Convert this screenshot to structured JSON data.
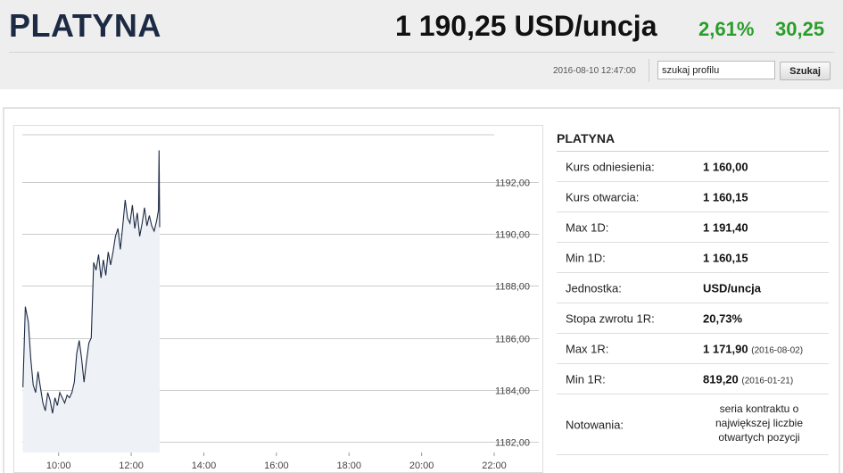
{
  "header": {
    "title": "PLATYNA",
    "price": "1 190,25 USD/uncja",
    "change_pct": "2,61%",
    "change_abs": "30,25",
    "timestamp": "2016-08-10 12:47:00",
    "search_value": "szukaj profilu",
    "search_button": "Szukaj",
    "accent_color": "#2a9d2a"
  },
  "info": {
    "title": "PLATYNA",
    "rows": [
      {
        "label": "Kurs odniesienia:",
        "value": "1 160,00",
        "note": ""
      },
      {
        "label": "Kurs otwarcia:",
        "value": "1 160,15",
        "note": ""
      },
      {
        "label": "Max 1D:",
        "value": "1 191,40",
        "note": ""
      },
      {
        "label": "Min 1D:",
        "value": "1 160,15",
        "note": ""
      },
      {
        "label": "Jednostka:",
        "value": "USD/uncja",
        "note": ""
      },
      {
        "label": "Stopa zwrotu 1R:",
        "value": "20,73%",
        "note": ""
      },
      {
        "label": "Max 1R:",
        "value": "1 171,90",
        "note": "(2016-08-02)"
      },
      {
        "label": "Min 1R:",
        "value": "819,20",
        "note": "(2016-01-21)"
      },
      {
        "label": "Notowania:",
        "value": "seria kontraktu o największej liczbie otwartych pozycji",
        "note": ""
      }
    ]
  },
  "chart_data": {
    "type": "area",
    "title": "",
    "xlabel": "",
    "ylabel": "",
    "grid": true,
    "xlim": [
      "09:00",
      "22:00"
    ],
    "ylim": [
      1181.6,
      1193.8
    ],
    "x_ticks": [
      "10:00",
      "12:00",
      "14:00",
      "16:00",
      "18:00",
      "20:00",
      "22:00"
    ],
    "y_ticks": [
      "1182,00",
      "1184,00",
      "1186,00",
      "1188,00",
      "1190,00",
      "1192,00"
    ],
    "series": [
      {
        "name": "",
        "x": [
          "09:01",
          "09:05",
          "09:10",
          "09:14",
          "09:18",
          "09:22",
          "09:26",
          "09:30",
          "09:34",
          "09:38",
          "09:42",
          "09:46",
          "09:50",
          "09:54",
          "09:58",
          "10:02",
          "10:06",
          "10:10",
          "10:14",
          "10:18",
          "10:22",
          "10:26",
          "10:30",
          "10:34",
          "10:38",
          "10:42",
          "10:46",
          "10:50",
          "10:54",
          "10:58",
          "11:02",
          "11:06",
          "11:10",
          "11:14",
          "11:18",
          "11:22",
          "11:26",
          "11:30",
          "11:34",
          "11:38",
          "11:42",
          "11:46",
          "11:50",
          "11:54",
          "11:58",
          "12:02",
          "12:06",
          "12:10",
          "12:14",
          "12:18",
          "12:22",
          "12:26",
          "12:30",
          "12:34",
          "12:38",
          "12:42",
          "12:45",
          "12:46",
          "12:47"
        ],
        "values": [
          1184.1,
          1187.2,
          1186.6,
          1185.2,
          1184.2,
          1183.9,
          1184.7,
          1184.1,
          1183.5,
          1183.2,
          1183.9,
          1183.6,
          1183.1,
          1183.7,
          1183.4,
          1183.9,
          1183.7,
          1183.5,
          1183.8,
          1183.7,
          1183.9,
          1184.3,
          1185.4,
          1185.9,
          1185.2,
          1184.3,
          1185.1,
          1185.8,
          1186.0,
          1188.9,
          1188.6,
          1189.2,
          1188.3,
          1189.0,
          1188.4,
          1189.3,
          1188.8,
          1189.3,
          1189.9,
          1190.2,
          1189.4,
          1190.3,
          1191.3,
          1190.6,
          1190.4,
          1191.1,
          1190.2,
          1190.8,
          1189.9,
          1190.4,
          1191.0,
          1190.3,
          1190.7,
          1190.3,
          1190.1,
          1190.5,
          1190.9,
          1193.2,
          1190.25
        ]
      }
    ]
  }
}
